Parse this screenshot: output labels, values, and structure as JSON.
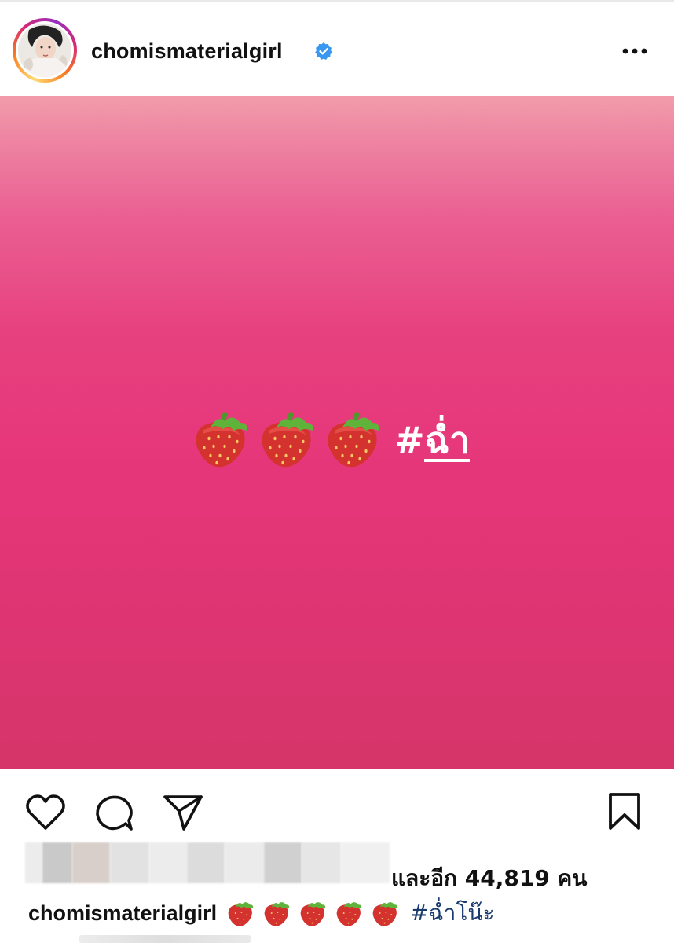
{
  "post": {
    "username": "chomismaterialgirl",
    "verified": true,
    "image": {
      "emoji": "strawberry-icon",
      "emoji_count": 3,
      "hashtag": "#ฉ่ำ",
      "background_top": "#f29cab",
      "background_bottom": "#d53569"
    },
    "likes": {
      "suffix": "และอีก 44,819 คน"
    },
    "caption": {
      "username": "chomismaterialgirl",
      "emoji_count": 5,
      "hashtag": "#ฉ่ำโน๊ะ"
    }
  },
  "colors": {
    "verified_blue": "#3897f0",
    "hashtag_link": "#1a3b6e",
    "text": "#111111"
  },
  "icons": {
    "more": "more-dots-icon",
    "like": "heart-icon",
    "comment": "comment-bubble-icon",
    "share": "paper-plane-icon",
    "save": "bookmark-icon"
  }
}
